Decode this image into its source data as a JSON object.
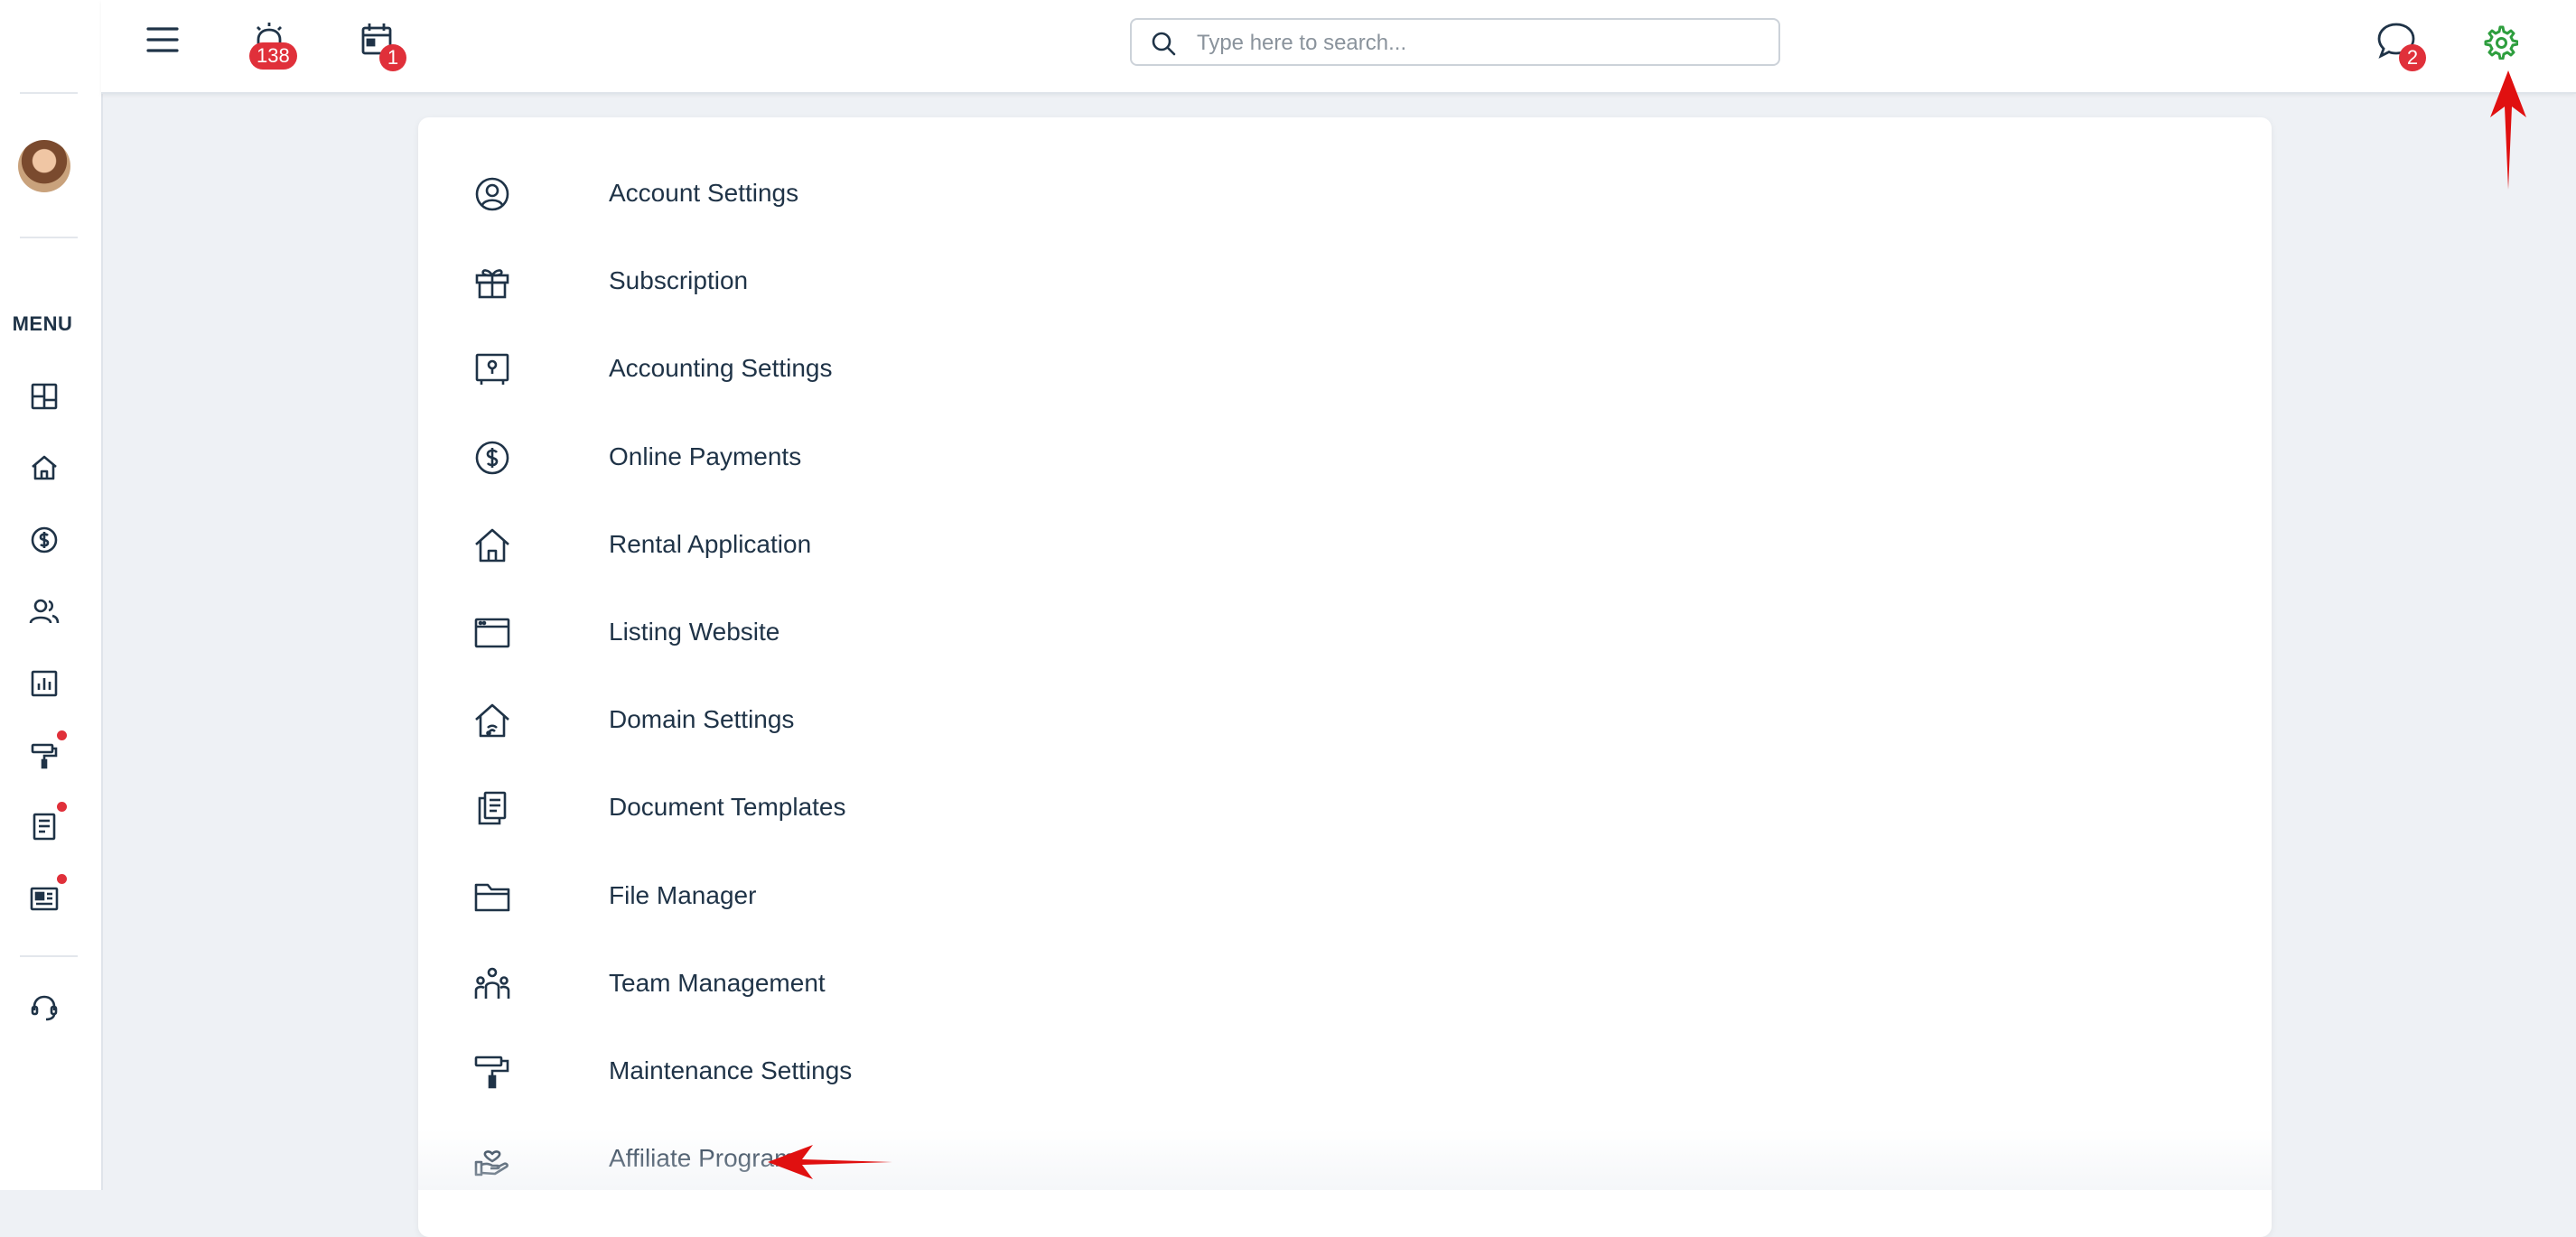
{
  "sidebar": {
    "menu_label": "MENU",
    "icons": [
      "dashboard-icon",
      "home-icon",
      "dollar-icon",
      "users-icon",
      "reports-icon",
      "maintenance-icon",
      "documents-icon",
      "news-icon",
      "support-icon"
    ]
  },
  "topbar": {
    "alarm_badge": "138",
    "calendar_badge": "1",
    "messages_badge": "2",
    "search_placeholder": "Type here to search...",
    "accent_color": "#2e9e3e",
    "badge_color": "#e0303a"
  },
  "settings_menu": {
    "items": [
      {
        "label": "Account Settings",
        "icon": "user-circle-icon"
      },
      {
        "label": "Subscription",
        "icon": "gift-icon"
      },
      {
        "label": "Accounting Settings",
        "icon": "safe-icon"
      },
      {
        "label": "Online Payments",
        "icon": "dollar-circle-icon"
      },
      {
        "label": "Rental Application",
        "icon": "house-icon"
      },
      {
        "label": "Listing Website",
        "icon": "browser-icon"
      },
      {
        "label": "Domain Settings",
        "icon": "house-wifi-icon"
      },
      {
        "label": "Document Templates",
        "icon": "document-copy-icon"
      },
      {
        "label": "File Manager",
        "icon": "folder-icon"
      },
      {
        "label": "Team Management",
        "icon": "team-icon"
      },
      {
        "label": "Maintenance Settings",
        "icon": "paint-roller-icon"
      },
      {
        "label": "Affiliate Program",
        "icon": "hand-heart-icon"
      }
    ]
  },
  "annotations": {
    "arrow_color": "#e01010"
  }
}
